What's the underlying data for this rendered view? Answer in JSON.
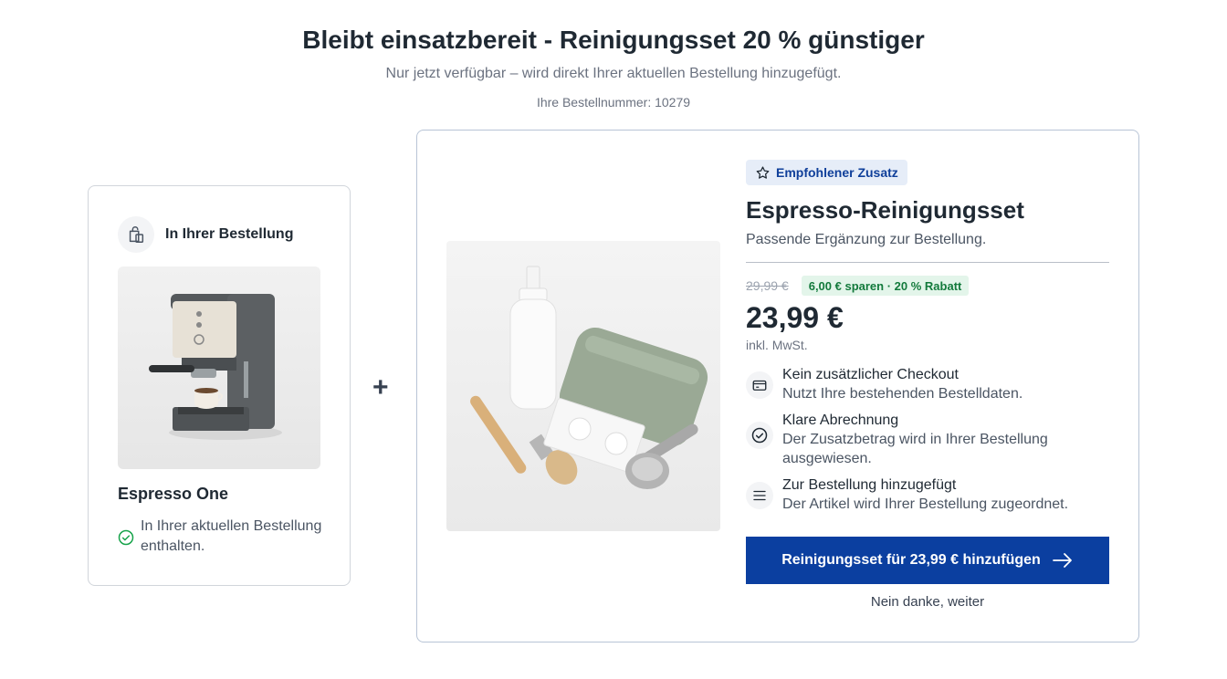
{
  "header": {
    "title": "Bleibt einsatzbereit - Reinigungsset 20 % günstiger",
    "subtitle": "Nur jetzt verfügbar – wird direkt Ihrer aktuellen Bestellung hinzugefügt.",
    "order_number": "Ihre Bestellnummer: 10279"
  },
  "current_order": {
    "label": "In Ihrer Bestellung",
    "product_name": "Espresso One",
    "status_text": "In Ihrer aktuellen Bestellung enthalten."
  },
  "plus_symbol": "+",
  "offer": {
    "badge": "Empfohlener Zusatz",
    "title": "Espresso-Reinigungsset",
    "subtitle": "Passende Ergänzung zur Bestellung.",
    "old_price": "29,99 €",
    "savings": "6,00 € sparen · 20 % Rabatt",
    "price": "23,99 €",
    "vat_note": "inkl. MwSt.",
    "benefits": [
      {
        "icon": "credit-card-icon",
        "title": "Kein zusätzlicher Checkout",
        "desc": "Nutzt Ihre bestehenden Bestelldaten."
      },
      {
        "icon": "check-circle-icon",
        "title": "Klare Abrechnung",
        "desc": "Der Zusatzbetrag wird in Ihrer Bestellung ausgewiesen."
      },
      {
        "icon": "list-icon",
        "title": "Zur Bestellung hinzugefügt",
        "desc": "Der Artikel wird Ihrer Bestellung zugeordnet."
      }
    ],
    "cta_label": "Reinigungsset für 23,99 € hinzufügen",
    "decline_label": "Nein danke, weiter"
  },
  "colors": {
    "primary": "#0b3fa0",
    "badge_bg": "#e6edf8",
    "savings_bg": "#e3f5ea",
    "savings_text": "#137a3c",
    "success": "#16a34a"
  }
}
